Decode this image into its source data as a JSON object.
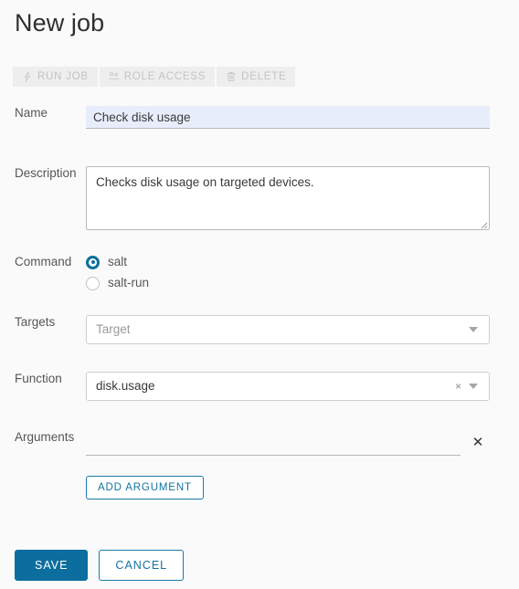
{
  "page": {
    "title": "New job",
    "background_color": "#fafafa",
    "accent_color": "#0b6e9e"
  },
  "toolbar": {
    "buttons": [
      {
        "label": "RUN JOB",
        "icon": "lightning-icon",
        "disabled": true
      },
      {
        "label": "ROLE ACCESS",
        "icon": "users-group-icon",
        "disabled": true
      },
      {
        "label": "DELETE",
        "icon": "trash-icon",
        "disabled": true
      }
    ]
  },
  "form": {
    "name": {
      "label": "Name",
      "value": "Check disk usage",
      "placeholder": "",
      "field_background": "#e8edfb"
    },
    "description": {
      "label": "Description",
      "value": "Checks disk usage on targeted devices.",
      "placeholder": ""
    },
    "command": {
      "label": "Command",
      "selected": "salt",
      "options": [
        {
          "label": "salt",
          "checked": true
        },
        {
          "label": "salt-run",
          "checked": false
        }
      ]
    },
    "targets": {
      "label": "Targets",
      "value": "",
      "placeholder": "Target",
      "caret_icon": "chevron-down-icon"
    },
    "function": {
      "label": "Function",
      "value": "disk.usage",
      "placeholder": "",
      "clear_icon": "close-icon",
      "clear_label": "×",
      "caret_icon": "chevron-down-icon"
    },
    "arguments": {
      "label": "Arguments",
      "value": "",
      "placeholder": "",
      "remove_label": "✕",
      "remove_icon": "close-icon"
    },
    "add_argument_label": "ADD ARGUMENT"
  },
  "footer": {
    "save_label": "SAVE",
    "cancel_label": "CANCEL"
  }
}
